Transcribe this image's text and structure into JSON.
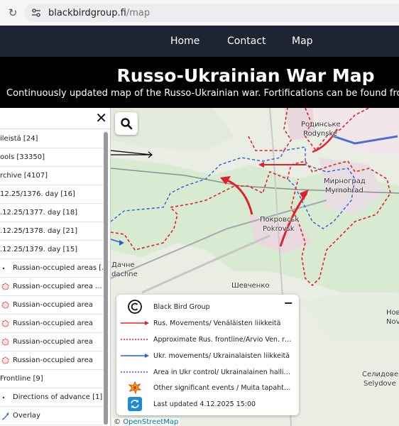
{
  "browser": {
    "url_host": "blackbirdgroup.fi",
    "url_path": "/map"
  },
  "nav": {
    "items": [
      "Home",
      "Contact",
      "Map"
    ]
  },
  "header": {
    "title": "Russo-Ukrainian War Map",
    "subtitle": "Continuously updated map of the Russo-Ukrainian war. Fortifications can be found from the item"
  },
  "panel": {
    "close_icon": "close-icon",
    "items": [
      {
        "label": "ileistä [24]",
        "icon": "none"
      },
      {
        "label": "ools [33350]",
        "icon": "none"
      },
      {
        "label": "rchive [4107]",
        "icon": "none"
      },
      {
        "label": "12.25/1376. day [16]",
        "icon": "none"
      },
      {
        "label": ".12.25/1377. day [18]",
        "icon": "none"
      },
      {
        "label": ".12.25/1378. day [21]",
        "icon": "none"
      },
      {
        "label": ".12.25/1379. day [15]",
        "icon": "none"
      },
      {
        "label": "Russian-occupied areas [...",
        "icon": "red-dot"
      },
      {
        "label": "Russian-occupied area ...",
        "icon": "red-area"
      },
      {
        "label": "Russian-occupied area",
        "icon": "red-area"
      },
      {
        "label": "Russian-occupied area",
        "icon": "red-area"
      },
      {
        "label": "Russian-occupied area",
        "icon": "red-area"
      },
      {
        "label": "Russian-occupied area",
        "icon": "red-area"
      },
      {
        "label": "Frontline [9]",
        "icon": "none"
      },
      {
        "label": "Directions of advance [1]",
        "icon": "dot"
      },
      {
        "label": "Overlay",
        "icon": "blue-arrow"
      }
    ]
  },
  "map": {
    "search_icon": "search-icon",
    "labels": {
      "rodynske_ua": "Родинське",
      "rodynske": "Rodynske",
      "myrnohrad_ua": "Мирноград",
      "myrnohrad": "Myrnohrad",
      "pokrovsk_ua": "Покровськ",
      "pokrovsk": "Pokrovsk",
      "dachne_ua": "Дачне",
      "dachne": "dachne",
      "shevchenko_ua": "Шевченко",
      "novo_ua": "Нов",
      "novo": "Nov",
      "selydove_ua": "Селидове",
      "selydove": "Selydove"
    },
    "attribution_prefix": "©",
    "attribution_link": "OpenStreetMap"
  },
  "legend": {
    "toggle": "−",
    "rows": [
      {
        "icon": "copyright-icon",
        "text": "Black Bird Group"
      },
      {
        "icon": "red-arrow-icon",
        "text": "Rus. Movements/ Venäläisten liikkeitä"
      },
      {
        "icon": "red-dashed-line-icon",
        "text": "Approximate Rus. frontline/Arvio Ven. rintamalinjasta"
      },
      {
        "icon": "blue-arrow-icon",
        "text": "Ukr. movements/ Ukrainalaisten liikkeitä"
      },
      {
        "icon": "blue-dashed-line-icon",
        "text": "Area in Ukr control/ Ukrainalainen hallinta"
      },
      {
        "icon": "explosion-icon",
        "text": "Other significant events / Muita tapahtumia"
      },
      {
        "icon": "refresh-icon",
        "text": "Last updated 4.12.2025 15:00"
      }
    ]
  },
  "colors": {
    "nav_bg": "#1e2432",
    "header_bg": "#000000",
    "russian_red": "#e0202a",
    "ukraine_blue": "#2a5fd8",
    "map_green": "#d8ead2"
  }
}
